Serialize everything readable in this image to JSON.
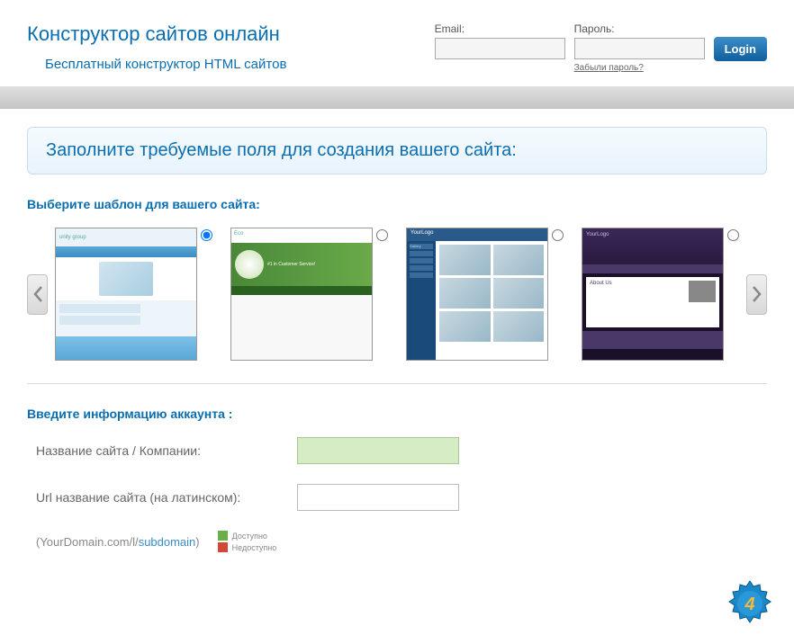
{
  "header": {
    "title": "Конструктор сайтов онлайн",
    "subtitle": "Бесплатный конструктор HTML сайтов"
  },
  "login": {
    "email_label": "Email:",
    "password_label": "Пароль:",
    "forgot_link": "Забыли пароль?",
    "button": "Login"
  },
  "main_heading": "Заполните требуемые поля для создания вашего сайта:",
  "templates": {
    "section_title": "Выберите шаблон для вашего сайта:",
    "items": [
      {
        "name": "unity group",
        "theme": "light-blue"
      },
      {
        "name": "Eco",
        "hero_text": "#1 in Customer Service!",
        "theme": "green"
      },
      {
        "name": "YourLogo",
        "side_label": "Gallery",
        "theme": "dark-blue"
      },
      {
        "name": "YourLogo",
        "body_title": "About Us",
        "theme": "purple"
      }
    ]
  },
  "account": {
    "section_title": "Введите информацию аккаунта :",
    "site_name_label": "Название сайта / Компании:",
    "url_name_label": "Url название сайта (на латинском):",
    "domain_prefix": "(YourDomain.com/l/",
    "domain_suffix": "subdomain",
    "domain_close": ")",
    "legend_available": "Доступно",
    "legend_unavailable": "Недоступно"
  }
}
